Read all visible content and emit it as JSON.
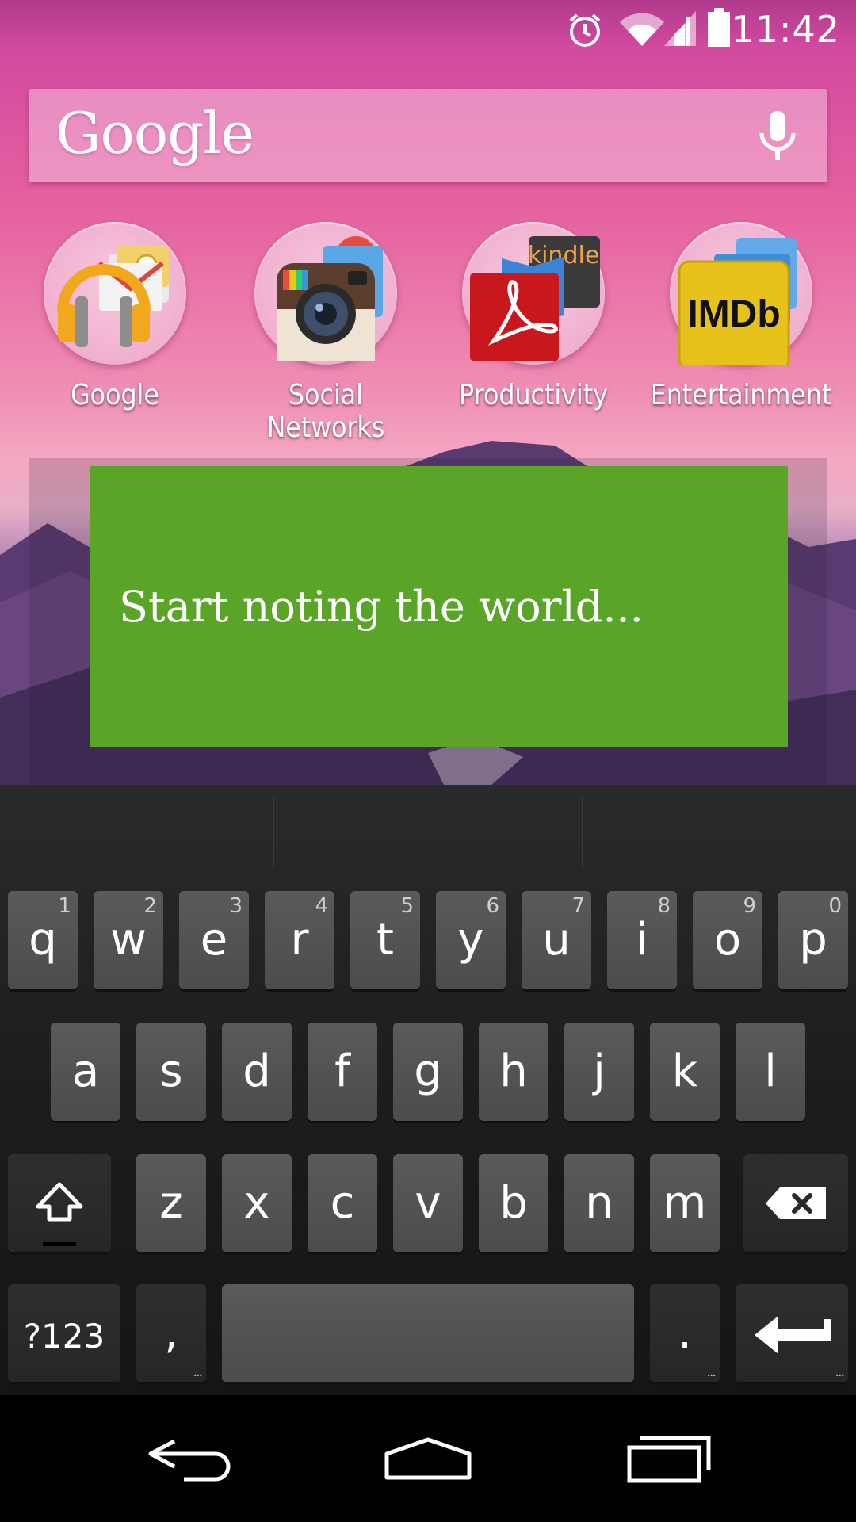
{
  "status_bar": {
    "time": "11:42",
    "icons": [
      "alarm-icon",
      "wifi-icon",
      "signal-icon",
      "battery-icon"
    ]
  },
  "search": {
    "logo": "Google",
    "mic_icon": "mic-icon"
  },
  "folders": [
    {
      "label": "Google"
    },
    {
      "label": "Social Networks"
    },
    {
      "label": "Productivity"
    },
    {
      "label": "Entertainment"
    }
  ],
  "folder_icon_text": {
    "kindle": "kindle",
    "imdb": "IMDb",
    "insta": "Insta"
  },
  "widget": {
    "note_placeholder": "Start noting the world..."
  },
  "keyboard": {
    "row1": [
      {
        "key": "q",
        "hint": "1"
      },
      {
        "key": "w",
        "hint": "2"
      },
      {
        "key": "e",
        "hint": "3"
      },
      {
        "key": "r",
        "hint": "4"
      },
      {
        "key": "t",
        "hint": "5"
      },
      {
        "key": "y",
        "hint": "6"
      },
      {
        "key": "u",
        "hint": "7"
      },
      {
        "key": "i",
        "hint": "8"
      },
      {
        "key": "o",
        "hint": "9"
      },
      {
        "key": "p",
        "hint": "0"
      }
    ],
    "row2": [
      "a",
      "s",
      "d",
      "f",
      "g",
      "h",
      "j",
      "k",
      "l"
    ],
    "row3": [
      "z",
      "x",
      "c",
      "v",
      "b",
      "n",
      "m"
    ],
    "symbols_label": "?123",
    "comma": ",",
    "period": ".",
    "more_dots": "...",
    "shift_icon": "shift-icon",
    "backspace_icon": "backspace-icon",
    "enter_icon": "enter-icon"
  },
  "nav_bar": {
    "icons": [
      "back-icon",
      "home-icon",
      "recents-icon"
    ]
  },
  "colors": {
    "note_green": "#5aa528",
    "key_gray": "#4c4c4c"
  }
}
